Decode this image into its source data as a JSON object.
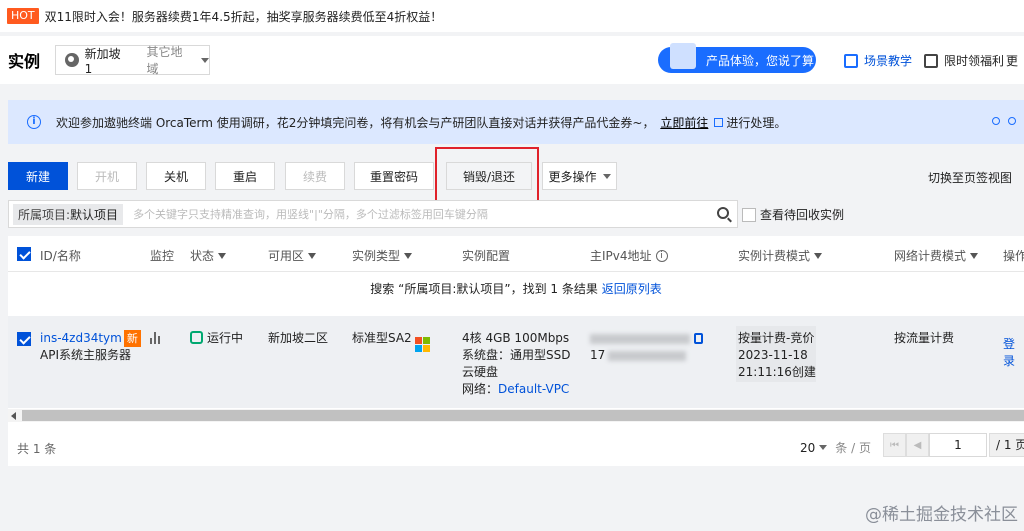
{
  "promo": {
    "badge": "HOT",
    "text": "双11限时入会！服务器续费1年4.5折起，抽奖享服务器续费低至4折权益！"
  },
  "header": {
    "title": "实例",
    "region": {
      "current": "新加坡 1",
      "other": "其它地域"
    },
    "feedback": "产品体验，您说了算",
    "links": [
      "场景教学",
      "限时领福利",
      "更"
    ]
  },
  "notice": {
    "text": "欢迎参加遨驰终端 OrcaTerm 使用调研，花2分钟填完问卷，将有机会与产研团队直接对话并获得产品代金券~，",
    "link": "立即前往",
    "tail": "进行处理。"
  },
  "toolbar": {
    "create": "新建",
    "start": "开机",
    "stop": "关机",
    "restart": "重启",
    "renew": "续费",
    "reset_password": "重置密码",
    "destroy": "销毁/退还",
    "more": "更多操作",
    "switch_view": "切换至页签视图"
  },
  "search": {
    "tag_key": "所属项目:",
    "tag_value": "默认项目",
    "placeholder": "多个关键字只支持精准查询，用竖线\"|\"分隔，多个过滤标签用回车键分隔",
    "recycle_label": "查看待回收实例"
  },
  "table": {
    "headers": {
      "id_name": "ID/名称",
      "monitor": "监控",
      "status": "状态",
      "zone": "可用区",
      "type": "实例类型",
      "config": "实例配置",
      "ipv4": "主IPv4地址",
      "billing": "实例计费模式",
      "net_billing": "网络计费模式",
      "ops": "操作"
    },
    "result": {
      "text": "搜索 “所属项目:默认项目”，找到 1 条结果",
      "back": "返回原列表"
    },
    "row": {
      "id": "ins-4zd34tym",
      "new_badge": "新",
      "name": "API系统主服务器",
      "status": "运行中",
      "zone": "新加坡二区",
      "type": "标准型SA2",
      "config_line1": "4核 4GB 100Mbps",
      "config_line2": "系统盘：通用型SSD云硬盘",
      "network_label": "网络：",
      "network": "Default-VPC",
      "ip_prefix": "17",
      "billing_mode": "按量计费-竞价",
      "created_date": "2023-11-18",
      "created_time": "21:11:16创建",
      "net_billing": "按流量计费",
      "op_login": "登录"
    }
  },
  "footer": {
    "total": "共 1 条",
    "page_size": "20",
    "page_size_unit": "条 / 页",
    "page": "1",
    "page_total": "/ 1 页"
  },
  "watermark": "@稀土掘金技术社区",
  "colors": {
    "primary": "#0052d9",
    "highlight": "#e0212a",
    "hot": "#ff5a1f",
    "running": "#00a870"
  }
}
